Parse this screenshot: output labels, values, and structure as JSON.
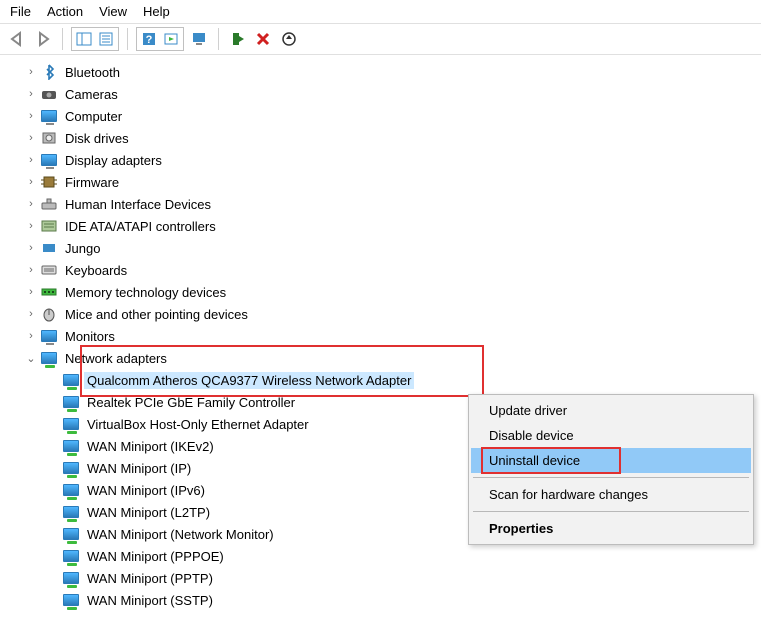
{
  "menu": {
    "file": "File",
    "action": "Action",
    "view": "View",
    "help": "Help"
  },
  "tree": [
    {
      "exp": "›",
      "icon": "bluetooth",
      "label": "Bluetooth"
    },
    {
      "exp": "›",
      "icon": "camera",
      "label": "Cameras"
    },
    {
      "exp": "›",
      "icon": "monitor",
      "label": "Computer"
    },
    {
      "exp": "›",
      "icon": "disk",
      "label": "Disk drives"
    },
    {
      "exp": "›",
      "icon": "monitor",
      "label": "Display adapters"
    },
    {
      "exp": "›",
      "icon": "firmware",
      "label": "Firmware"
    },
    {
      "exp": "›",
      "icon": "hid",
      "label": "Human Interface Devices"
    },
    {
      "exp": "›",
      "icon": "ide",
      "label": "IDE ATA/ATAPI controllers"
    },
    {
      "exp": "›",
      "icon": "jungo",
      "label": "Jungo"
    },
    {
      "exp": "›",
      "icon": "keyboard",
      "label": "Keyboards"
    },
    {
      "exp": "›",
      "icon": "memory",
      "label": "Memory technology devices"
    },
    {
      "exp": "›",
      "icon": "mouse",
      "label": "Mice and other pointing devices"
    },
    {
      "exp": "›",
      "icon": "monitor",
      "label": "Monitors"
    },
    {
      "exp": "⌄",
      "icon": "net",
      "label": "Network adapters",
      "expanded": true,
      "highlight": true
    }
  ],
  "children": [
    {
      "label": "Qualcomm Atheros QCA9377 Wireless Network Adapter",
      "selected": true
    },
    {
      "label": "Realtek PCIe GbE Family Controller"
    },
    {
      "label": "VirtualBox Host-Only Ethernet Adapter"
    },
    {
      "label": "WAN Miniport (IKEv2)"
    },
    {
      "label": "WAN Miniport (IP)"
    },
    {
      "label": "WAN Miniport (IPv6)"
    },
    {
      "label": "WAN Miniport (L2TP)"
    },
    {
      "label": "WAN Miniport (Network Monitor)"
    },
    {
      "label": "WAN Miniport (PPPOE)"
    },
    {
      "label": "WAN Miniport (PPTP)"
    },
    {
      "label": "WAN Miniport (SSTP)"
    }
  ],
  "ctx": {
    "update": "Update driver",
    "disable": "Disable device",
    "uninstall": "Uninstall device",
    "scan": "Scan for hardware changes",
    "properties": "Properties"
  }
}
